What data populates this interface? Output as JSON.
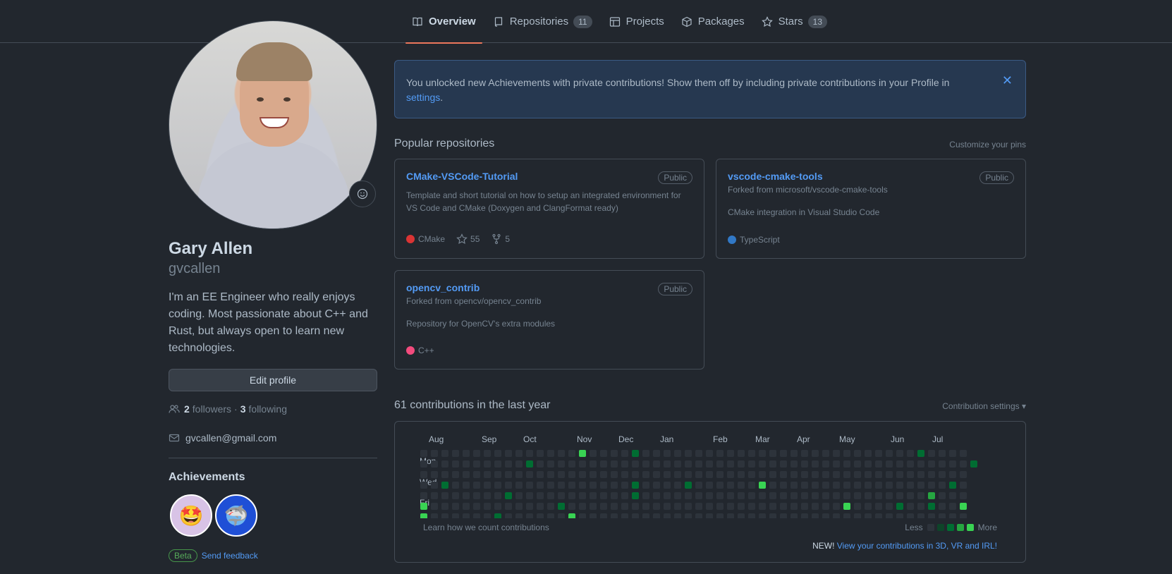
{
  "tabs": [
    {
      "label": "Overview",
      "icon": "book-icon",
      "active": true
    },
    {
      "label": "Repositories",
      "icon": "repo-icon",
      "count": "11"
    },
    {
      "label": "Projects",
      "icon": "table-icon"
    },
    {
      "label": "Packages",
      "icon": "package-icon"
    },
    {
      "label": "Stars",
      "icon": "star-icon",
      "count": "13"
    }
  ],
  "profile": {
    "name": "Gary Allen",
    "login": "gvcallen",
    "bio": "I'm an EE Engineer who really enjoys coding. Most passionate about C++ and Rust, but always open to learn new technologies.",
    "edit_label": "Edit profile",
    "followers_count": "2",
    "followers_label": "followers",
    "separator": "·",
    "following_count": "3",
    "following_label": "following",
    "email": "gvcallen@gmail.com",
    "achievements_title": "Achievements",
    "beta_label": "Beta",
    "feedback_label": "Send feedback"
  },
  "flash": {
    "text": "You unlocked new Achievements with private contributions! Show them off by including private contributions in your Profile in",
    "link": "settings",
    "end": ".",
    "close": "✕"
  },
  "popular": {
    "title": "Popular repositories",
    "customize": "Customize your pins",
    "repos": [
      {
        "name": "CMake-VSCode-Tutorial",
        "visibility": "Public",
        "forked_from": "",
        "description": "Template and short tutorial on how to setup an integrated environment for VS Code and CMake (Doxygen and ClangFormat ready)",
        "language": "CMake",
        "lang_color": "#da3434",
        "stars": "55",
        "forks": "5"
      },
      {
        "name": "vscode-cmake-tools",
        "visibility": "Public",
        "forked_from": "Forked from microsoft/vscode-cmake-tools",
        "description": "CMake integration in Visual Studio Code",
        "language": "TypeScript",
        "lang_color": "#3178c6"
      },
      {
        "name": "opencv_contrib",
        "visibility": "Public",
        "forked_from": "Forked from opencv/opencv_contrib",
        "description": "Repository for OpenCV's extra modules",
        "language": "C++",
        "lang_color": "#f34b7d"
      }
    ]
  },
  "contributions": {
    "title": "61 contributions in the last year",
    "settings": "Contribution settings ▾",
    "months": [
      "Aug",
      "Sep",
      "Oct",
      "Nov",
      "Dec",
      "Jan",
      "Feb",
      "Mar",
      "Apr",
      "May",
      "Jun",
      "Jul"
    ],
    "days": [
      "Mon",
      "Wed",
      "Fri"
    ],
    "learn": "Learn how we count contributions",
    "less": "Less",
    "more": "More",
    "new_label": "NEW!",
    "new_link": "View your contributions in 3D, VR and IRL!",
    "colors": [
      "#2d333b",
      "#0e4429",
      "#006d32",
      "#26a641",
      "#39d353"
    ]
  }
}
